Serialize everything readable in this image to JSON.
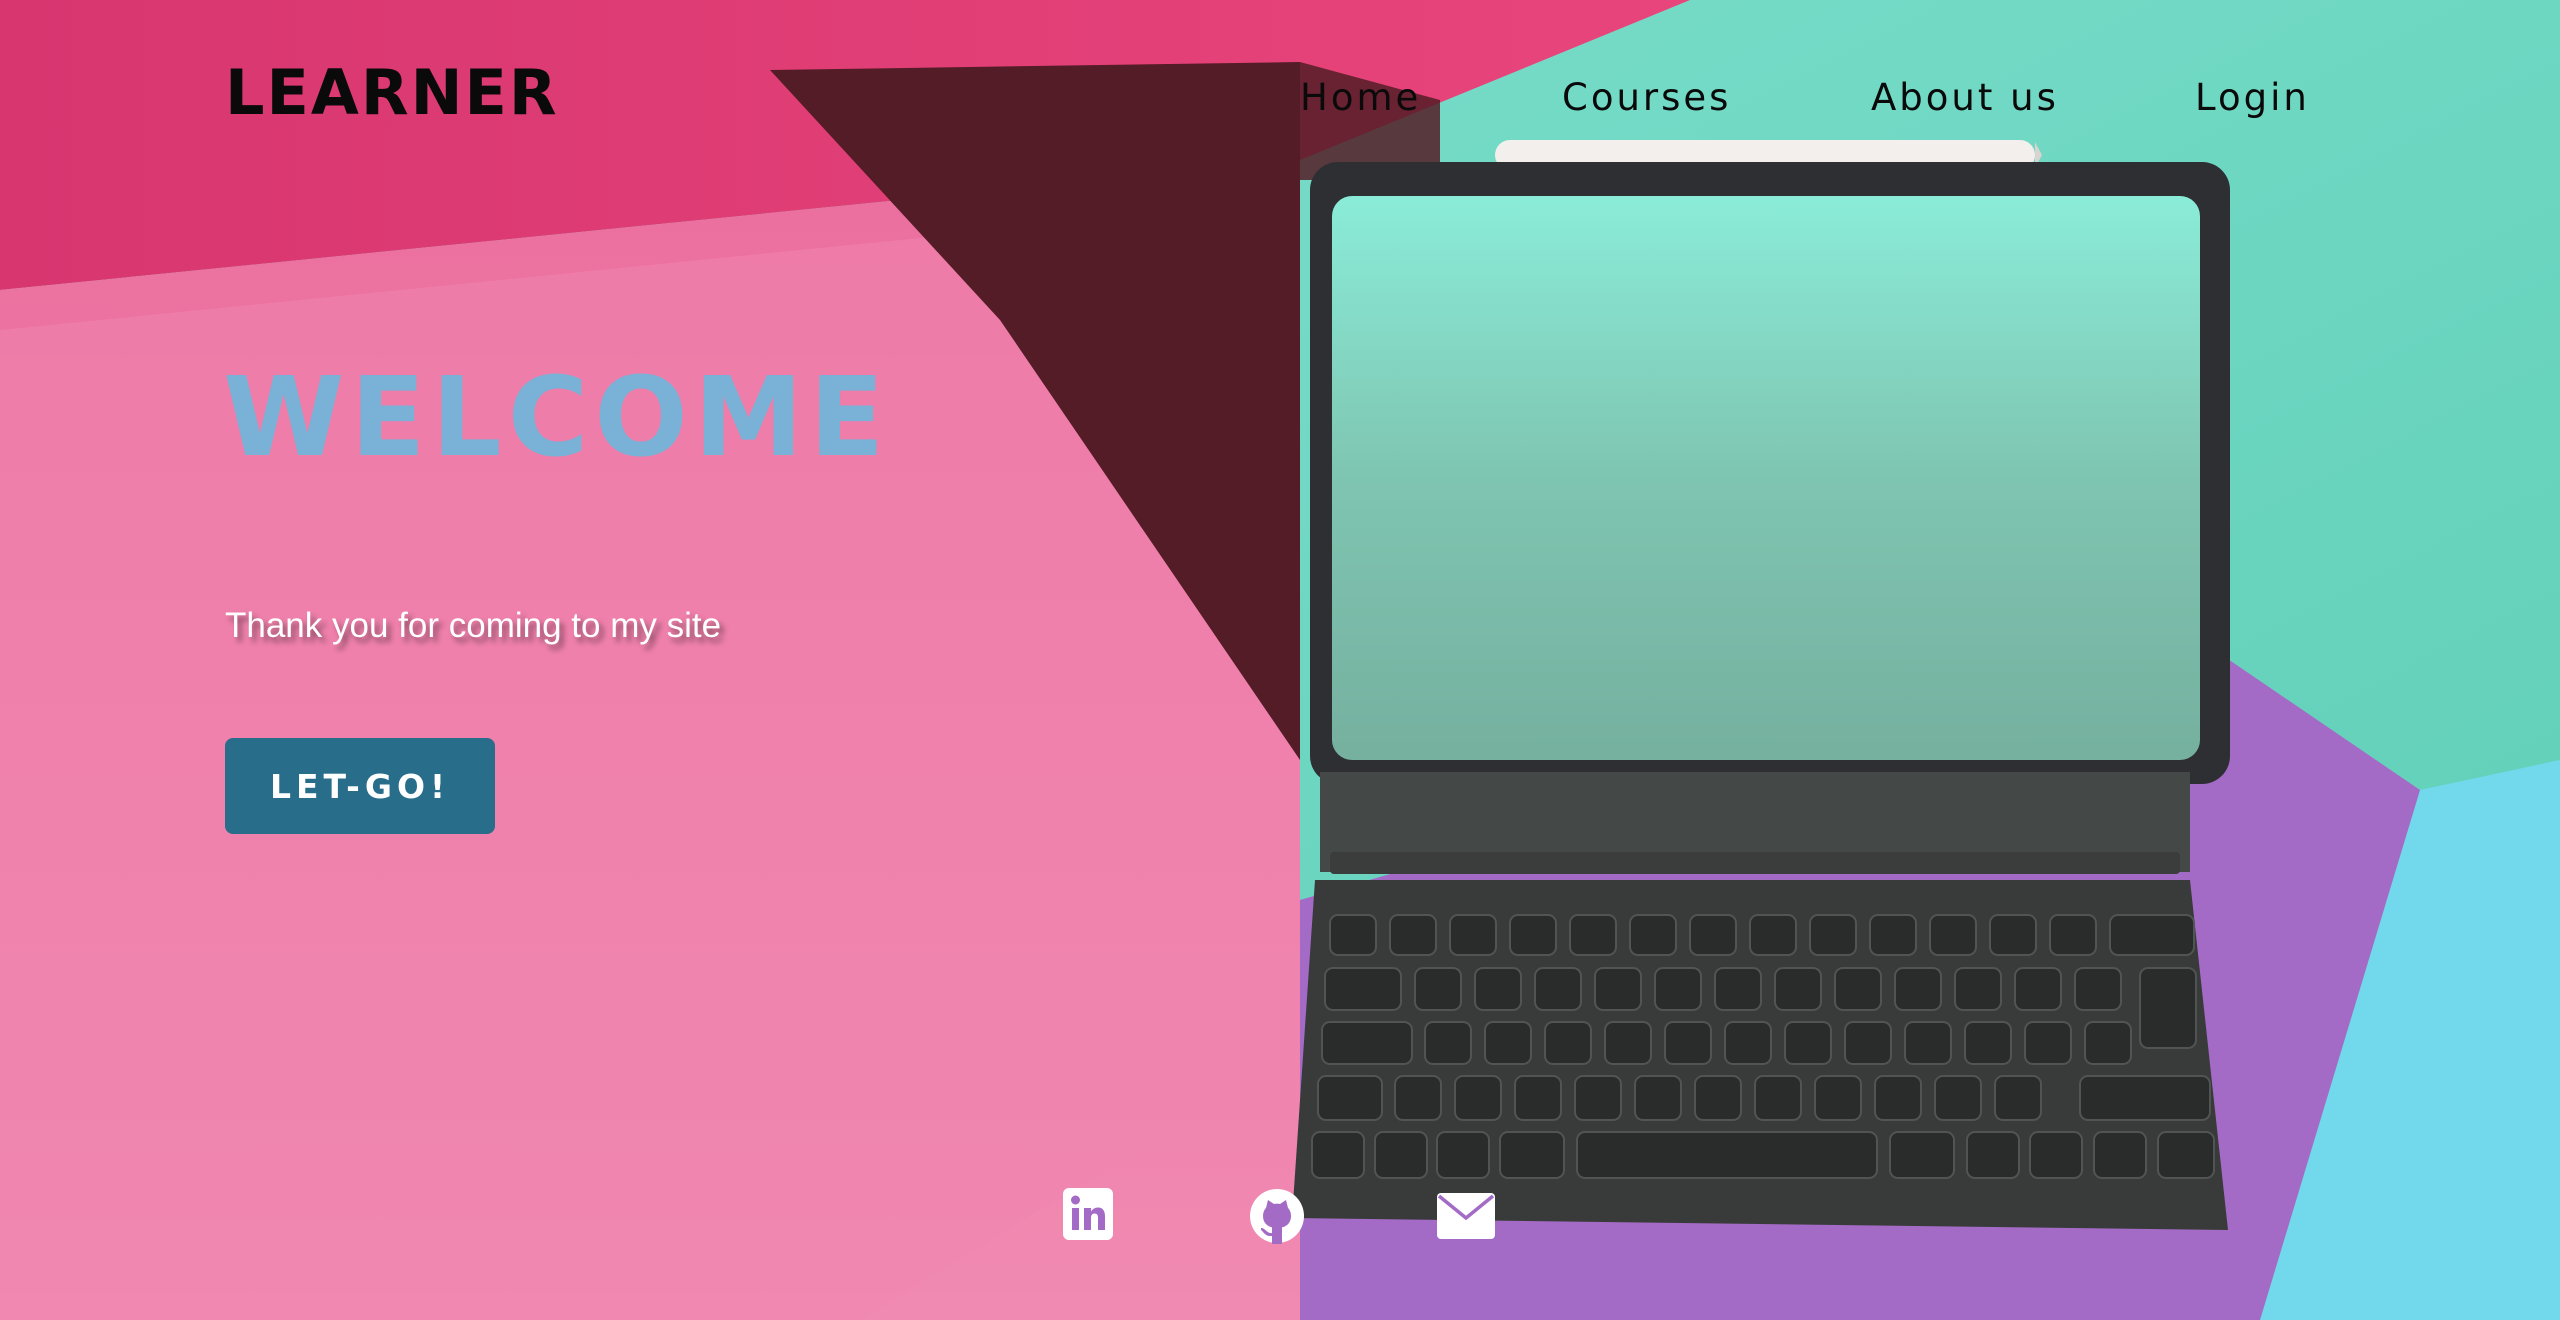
{
  "brand": {
    "logo_text": "LEARNER"
  },
  "nav": {
    "items": [
      {
        "label": "Home"
      },
      {
        "label": "Courses"
      },
      {
        "label": "About us"
      },
      {
        "label": "Login"
      }
    ]
  },
  "hero": {
    "title": "WELCOME",
    "tagline": "Thank you for coming to my site",
    "cta_label": "LET-GO!"
  },
  "social": [
    {
      "icon": "linkedin-icon"
    },
    {
      "icon": "github-icon"
    },
    {
      "icon": "mail-icon"
    }
  ],
  "colors": {
    "pink": "#e94f8a",
    "teal": "#6ed6c0",
    "purple": "#a06ac4",
    "cyan": "#6fd5e8",
    "welcome": "#7ab1d6",
    "button": "#286d8a"
  }
}
